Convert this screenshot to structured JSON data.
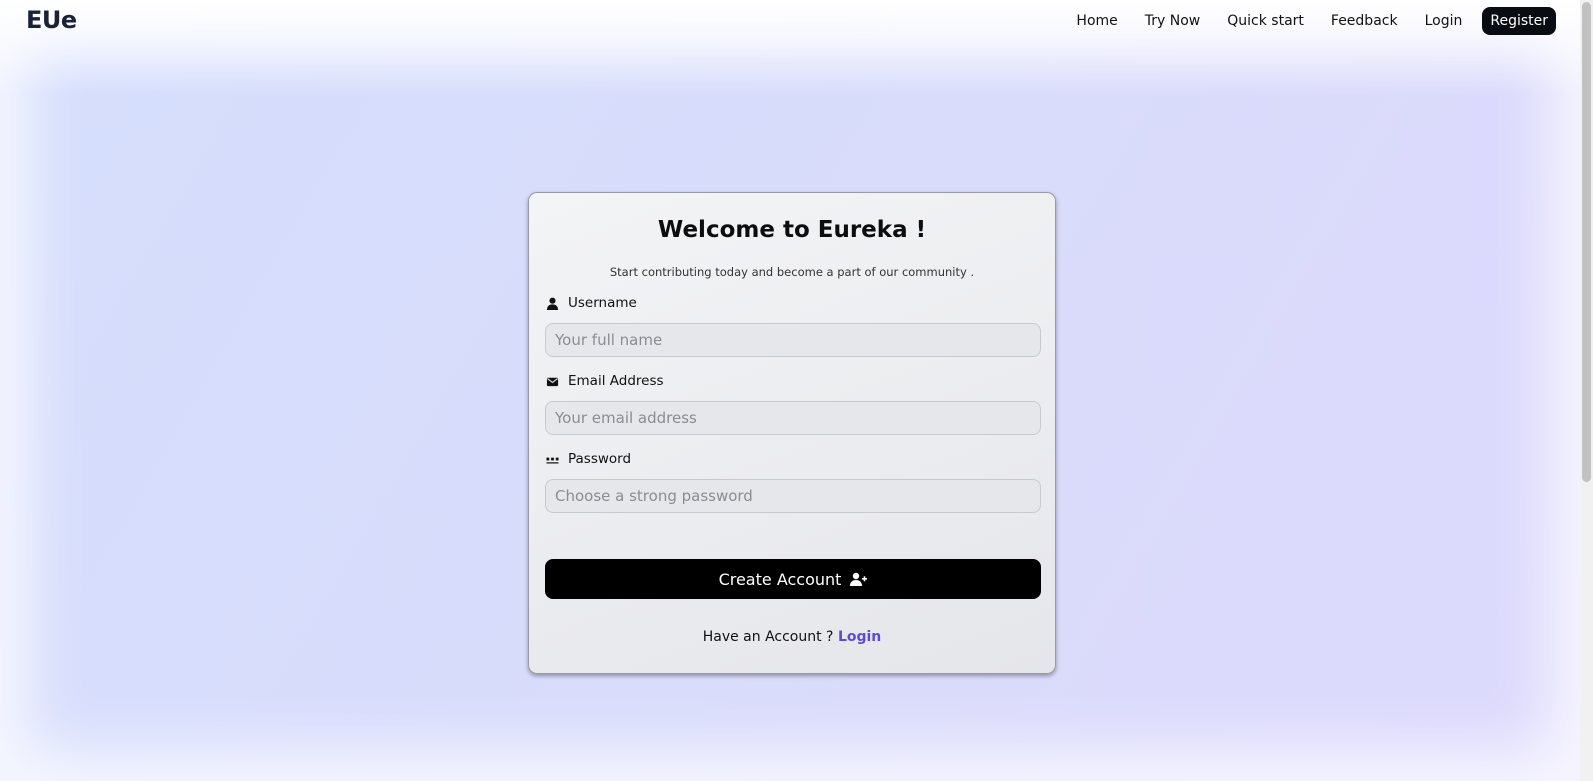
{
  "header": {
    "logo": "EUe",
    "nav": [
      "Home",
      "Try Now",
      "Quick start",
      "Feedback",
      "Login"
    ],
    "register_label": "Register"
  },
  "card": {
    "title": "Welcome to Eureka !",
    "subtitle": "Start contributing today and become a part of our community .",
    "fields": {
      "username": {
        "label": "Username",
        "placeholder": "Your full name",
        "icon": "user-icon"
      },
      "email": {
        "label": "Email Address",
        "placeholder": "Your email address",
        "icon": "envelope-icon"
      },
      "password": {
        "label": "Password",
        "placeholder": "Choose a strong password",
        "icon": "password-dots-icon"
      }
    },
    "submit_label": "Create Account",
    "footer_text": "Have an Account ?",
    "footer_link": "Login"
  },
  "colors": {
    "accent_link": "#5a4bd6",
    "button_bg": "#000000",
    "register_bg": "#0a0c14"
  }
}
